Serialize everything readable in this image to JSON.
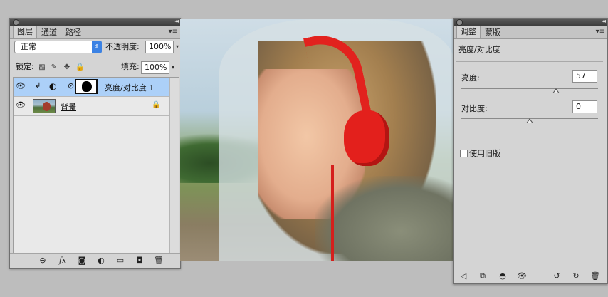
{
  "layers_panel": {
    "tabs": [
      "图层",
      "通道",
      "路径"
    ],
    "blend_mode": "正常",
    "opacity_label": "不透明度:",
    "opacity_value": "100%",
    "lock_label": "锁定:",
    "fill_label": "填充:",
    "fill_value": "100%",
    "layers": [
      {
        "name": "亮度/对比度 1",
        "selected": true,
        "visible": true,
        "type": "adjustment"
      },
      {
        "name": "背景",
        "selected": false,
        "visible": true,
        "type": "background",
        "locked": true
      }
    ],
    "bottom_icons": [
      "link-icon",
      "fx-icon",
      "mask-icon",
      "adjustment-icon",
      "folder-icon",
      "new-layer-icon",
      "trash-icon"
    ]
  },
  "adjustments_panel": {
    "tabs": [
      "调整",
      "蒙版"
    ],
    "title": "亮度/对比度",
    "brightness_label": "亮度:",
    "brightness_value": "57",
    "contrast_label": "对比度:",
    "contrast_value": "0",
    "legacy_label": "使用旧版",
    "legacy_checked": false,
    "bottom_icons": [
      "back-arrow-icon",
      "expand-icon",
      "clip-icon",
      "eye-icon",
      "reset-previous-icon",
      "reset-icon",
      "trash-icon"
    ]
  },
  "colors": {
    "selected_layer": "#acd0f8",
    "blend_arrow": "#3b82e4",
    "headphones": "#e2221e"
  }
}
